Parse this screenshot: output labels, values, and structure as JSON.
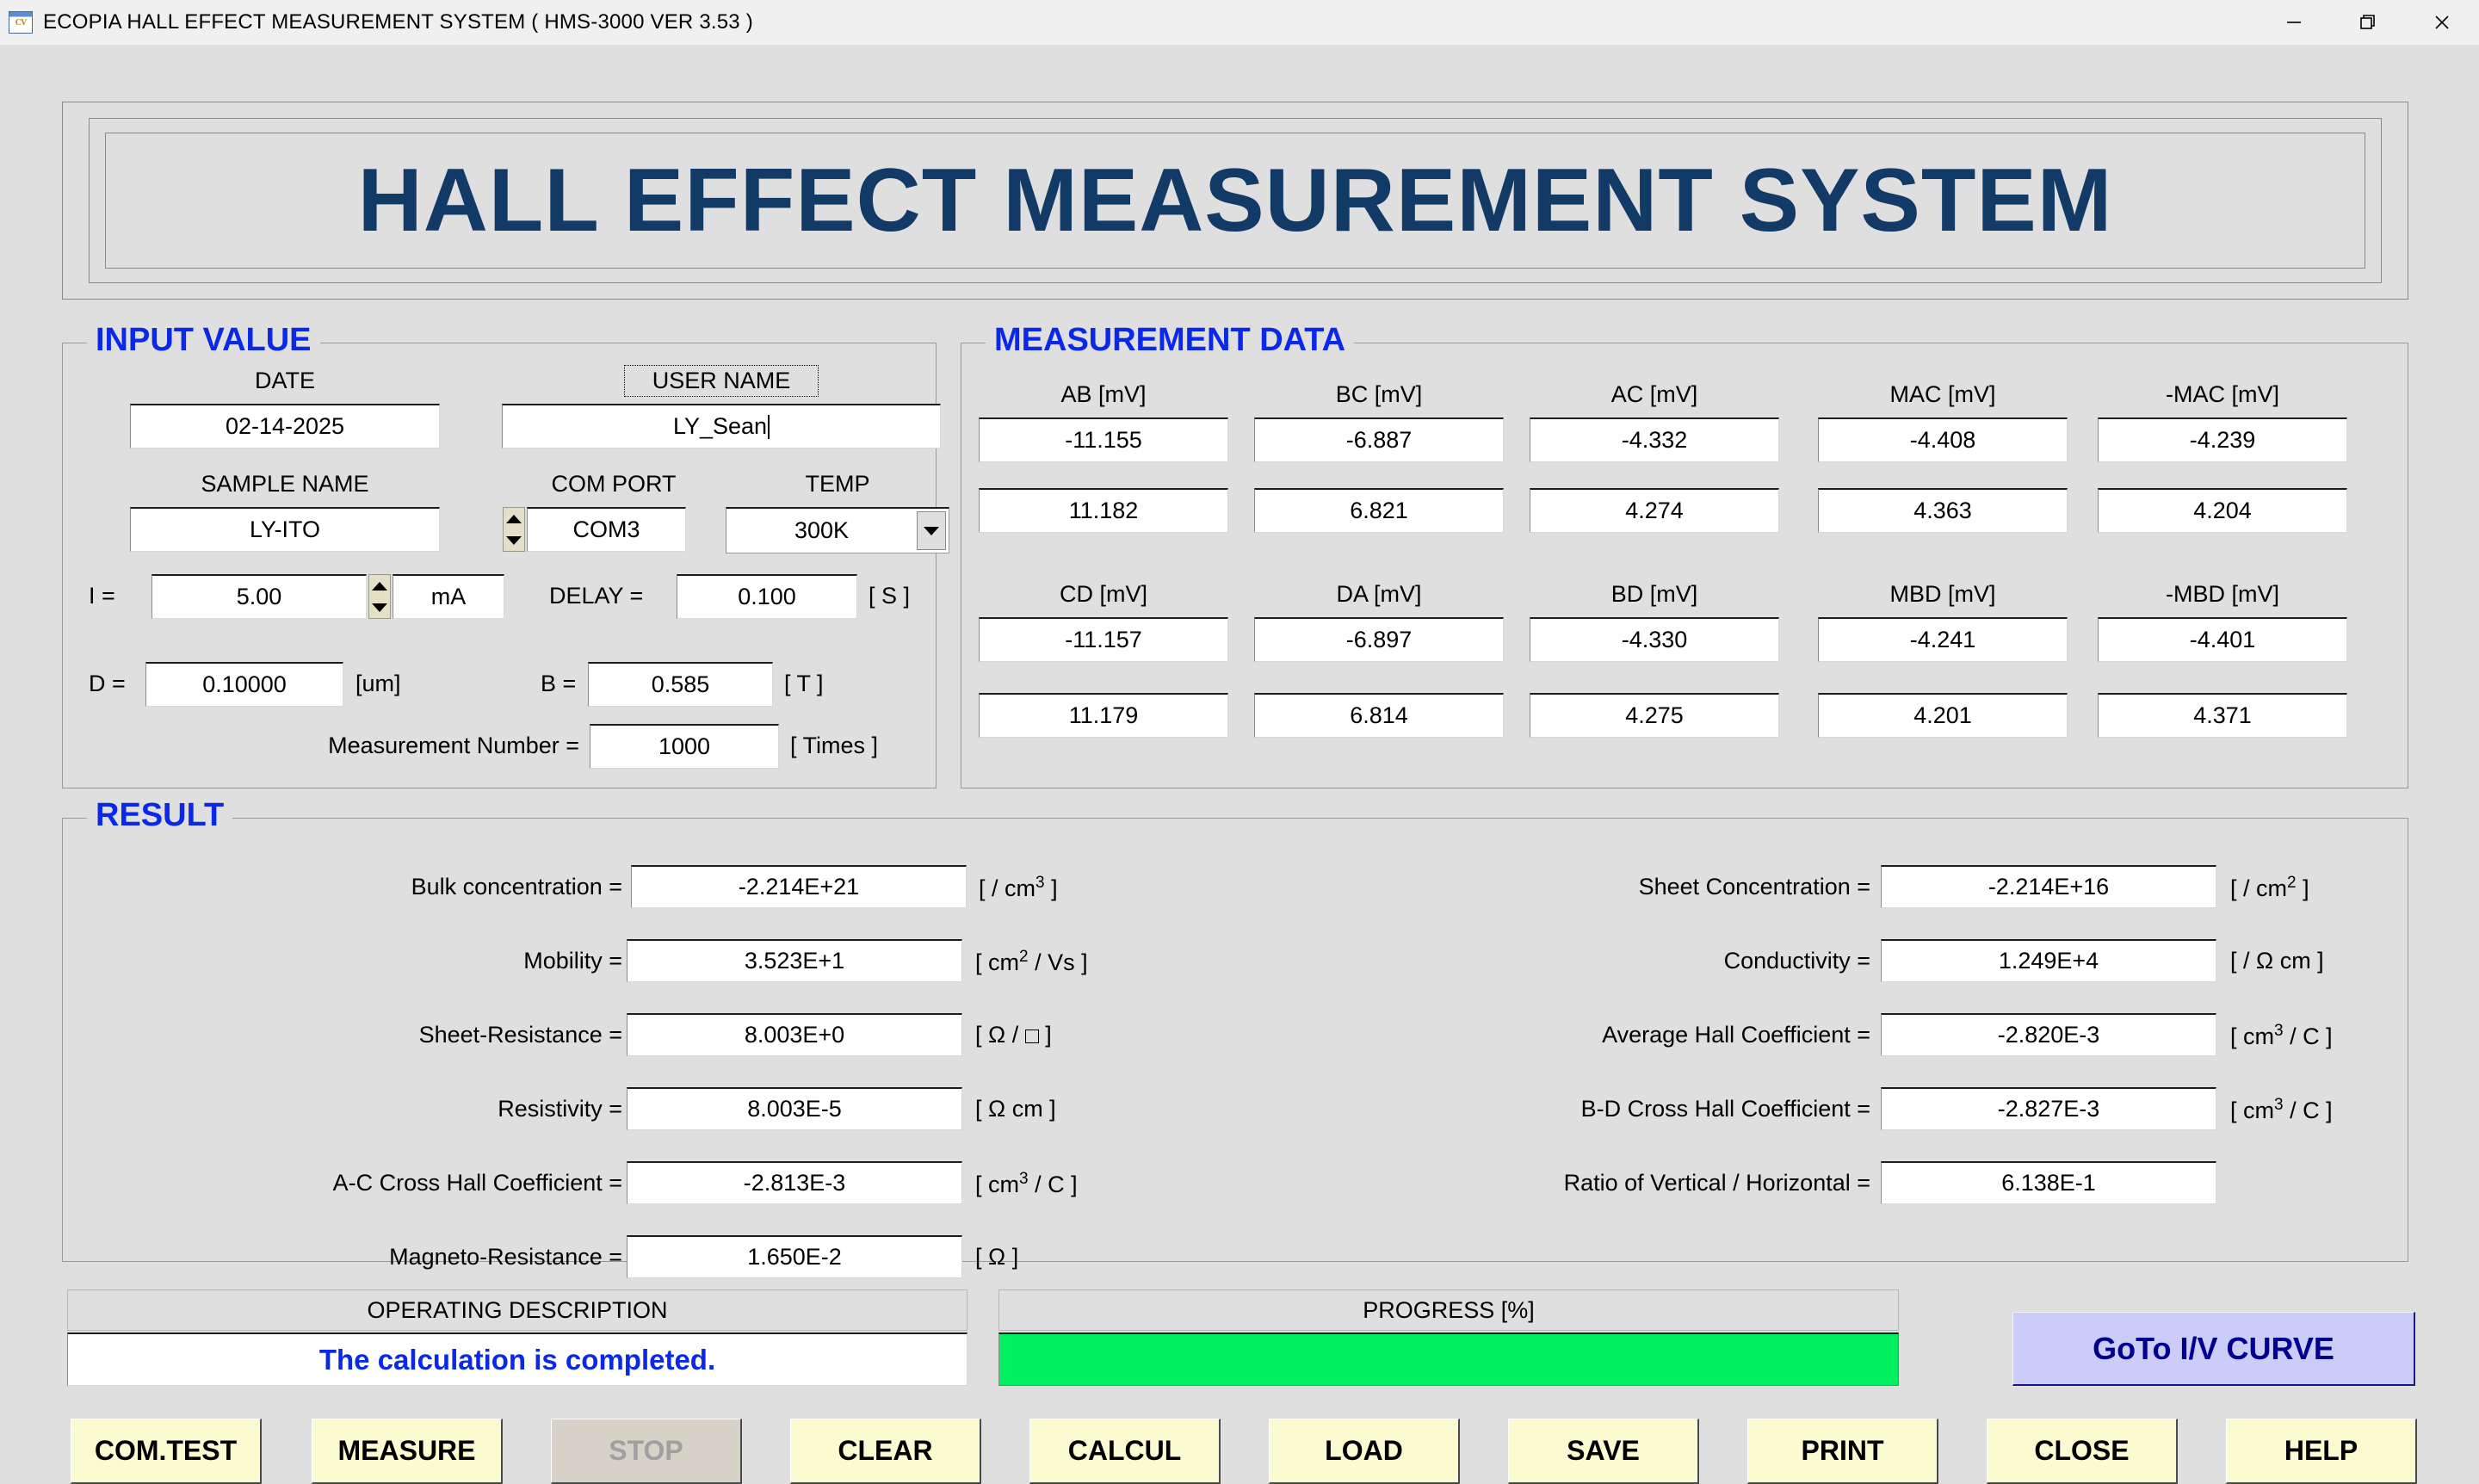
{
  "window": {
    "title": "ECOPIA HALL EFFECT MEASUREMENT SYSTEM ( HMS-3000  VER 3.53 )",
    "icon": "app-icon",
    "minimize_label": "minimize-icon",
    "restore_label": "restore-icon",
    "close_label": "close-icon"
  },
  "banner": {
    "title": "HALL EFFECT MEASUREMENT SYSTEM"
  },
  "input_value": {
    "group_title": "INPUT VALUE",
    "date_label": "DATE",
    "date_value": "02-14-2025",
    "user_name_label": "USER NAME",
    "user_name_value": "LY_Sean",
    "sample_name_label": "SAMPLE NAME",
    "sample_name_value": "LY-ITO",
    "com_port_label": "COM PORT",
    "com_port_value": "COM3",
    "temp_label": "TEMP",
    "temp_value": "300K",
    "current_label": "I  =",
    "current_value": "5.00",
    "current_unit_value": "mA",
    "delay_label": "DELAY =",
    "delay_value": "0.100",
    "delay_unit": "[ S ]",
    "thickness_label": "D =",
    "thickness_value": "0.10000",
    "thickness_unit": "[um]",
    "field_label": "B =",
    "field_value": "0.585",
    "field_unit": "[ T ]",
    "meas_number_label": "Measurement Number  =",
    "meas_number_value": "1000",
    "meas_number_unit": "[ Times ]"
  },
  "measurement_data": {
    "group_title": "MEASUREMENT   DATA",
    "row1_headers": [
      "AB [mV]",
      "BC [mV]",
      "AC [mV]",
      "MAC [mV]",
      "-MAC [mV]"
    ],
    "row1_values": [
      "-11.155",
      "-6.887",
      "-4.332",
      "-4.408",
      "-4.239"
    ],
    "row2_values": [
      "11.182",
      "6.821",
      "4.274",
      "4.363",
      "4.204"
    ],
    "row3_headers": [
      "CD [mV]",
      "DA [mV]",
      "BD [mV]",
      "MBD [mV]",
      "-MBD [mV]"
    ],
    "row3_values": [
      "-11.157",
      "-6.897",
      "-4.330",
      "-4.241",
      "-4.401"
    ],
    "row4_values": [
      "11.179",
      "6.814",
      "4.275",
      "4.201",
      "4.371"
    ]
  },
  "result": {
    "group_title": "RESULT",
    "left": [
      {
        "label": "Bulk concentration =",
        "value": "-2.214E+21",
        "unit_pre": "[ / cm",
        "unit_sup": "3",
        "unit_post": "]"
      },
      {
        "label": "Mobility =",
        "value": "3.523E+1",
        "unit_pre": "[ cm",
        "unit_sup": "2",
        "unit_post": "/  Vs ]"
      },
      {
        "label": "Sheet-Resistance =",
        "value": "8.003E+0",
        "unit_pre": "[ Ω  /",
        "unit_sup": "",
        "unit_post": "]"
      },
      {
        "label": "Resistivity =",
        "value": "8.003E-5",
        "unit_pre": "[ Ω cm ]",
        "unit_sup": "",
        "unit_post": ""
      },
      {
        "label": "A-C Cross Hall Coefficient =",
        "value": "-2.813E-3",
        "unit_pre": "[ cm",
        "unit_sup": "3",
        "unit_post": "/ C ]"
      },
      {
        "label": "Magneto-Resistance =",
        "value": "1.650E-2",
        "unit_pre": "[ Ω ]",
        "unit_sup": "",
        "unit_post": ""
      }
    ],
    "right": [
      {
        "label": "Sheet Concentration =",
        "value": "-2.214E+16",
        "unit_pre": "[ / cm",
        "unit_sup": "2",
        "unit_post": "]"
      },
      {
        "label": "Conductivity =",
        "value": "1.249E+4",
        "unit_pre": "[ /  Ω cm ]",
        "unit_sup": "",
        "unit_post": ""
      },
      {
        "label": "Average Hall Coefficient =",
        "value": "-2.820E-3",
        "unit_pre": "[ cm",
        "unit_sup": "3",
        "unit_post": "/ C ]"
      },
      {
        "label": "B-D Cross Hall Coefficient =",
        "value": "-2.827E-3",
        "unit_pre": "[ cm",
        "unit_sup": "3",
        "unit_post": "/ C ]"
      },
      {
        "label": "Ratio of Vertical / Horizontal =",
        "value": "6.138E-1",
        "unit_pre": "",
        "unit_sup": "",
        "unit_post": ""
      }
    ]
  },
  "status": {
    "operating_caption": "OPERATING   DESCRIPTION",
    "operating_message": "The calculation  is completed.",
    "progress_caption": "PROGRESS [%]",
    "progress_percent": 100,
    "goto_iv_label": "GoTo I/V CURVE"
  },
  "buttons": [
    {
      "label": "COM.TEST",
      "disabled": false
    },
    {
      "label": "MEASURE",
      "disabled": false
    },
    {
      "label": "STOP",
      "disabled": true
    },
    {
      "label": "CLEAR",
      "disabled": false
    },
    {
      "label": "CALCUL",
      "disabled": false
    },
    {
      "label": "LOAD",
      "disabled": false
    },
    {
      "label": "SAVE",
      "disabled": false
    },
    {
      "label": "PRINT",
      "disabled": false
    },
    {
      "label": "CLOSE",
      "disabled": false
    },
    {
      "label": "HELP",
      "disabled": false
    }
  ],
  "colors": {
    "window_bg": "#dfdfdf",
    "group_title": "#0a28e8",
    "banner_text": "#123a66",
    "progress_fill": "#00f060",
    "button_face": "#fbfbd2",
    "goto_face": "#ccccf8"
  }
}
